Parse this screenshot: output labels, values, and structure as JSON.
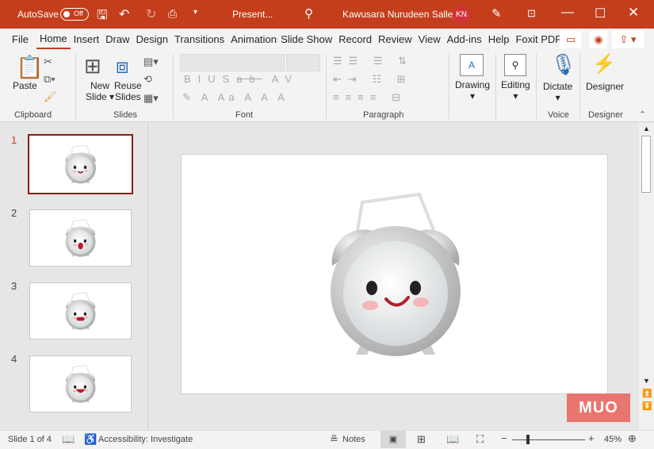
{
  "titlebar": {
    "autosave": "AutoSave",
    "toggle": "Off",
    "doc": "Present...",
    "user": "Kawusara Nurudeen Salley",
    "initials": "KN"
  },
  "tabs": [
    "File",
    "Home",
    "Insert",
    "Draw",
    "Design",
    "Transitions",
    "Animations",
    "Slide Show",
    "Record",
    "Review",
    "View",
    "Add-ins",
    "Help",
    "Foxit PDF"
  ],
  "ribbon": {
    "paste": "Paste",
    "new_slide": "New",
    "new_slide2": "Slide",
    "reuse": "Reuse",
    "reuse2": "Slides",
    "drawing": "Drawing",
    "editing": "Editing",
    "dictate": "Dictate",
    "designer": "Designer",
    "groups": {
      "clipboard": "Clipboard",
      "slides": "Slides",
      "font": "Font",
      "paragraph": "Paragraph",
      "voice": "Voice",
      "designer": "Designer"
    }
  },
  "thumbnails": [
    "1",
    "2",
    "3",
    "4"
  ],
  "watermark": "MUO",
  "status": {
    "slide": "Slide 1 of 4",
    "accessibility": "Accessibility: Investigate",
    "notes": "Notes",
    "zoom": "45%",
    "zoom_fraction": 0.45
  },
  "colors": {
    "accent": "#c43e1c"
  }
}
